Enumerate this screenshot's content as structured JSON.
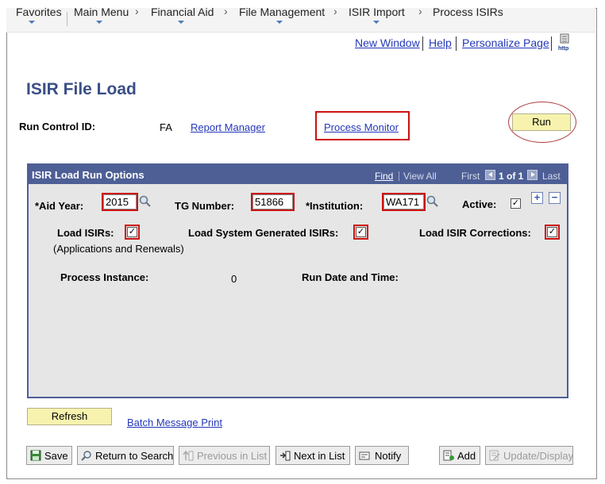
{
  "nav": {
    "items": [
      "Favorites",
      "Main Menu",
      "Financial Aid",
      "File Management",
      "ISIR Import",
      "Process ISIRs"
    ]
  },
  "toplinks": {
    "new_window": "New Window",
    "help": "Help",
    "personalize": "Personalize Page"
  },
  "icon_http_text": "http",
  "page_title": "ISIR File Load",
  "run_control": {
    "label": "Run Control ID:",
    "value": "FA",
    "report_manager": "Report Manager",
    "process_monitor": "Process Monitor",
    "run_button": "Run"
  },
  "panel": {
    "title": "ISIR Load Run Options",
    "find": "Find",
    "view_all": "View All",
    "first": "First",
    "count": "1 of 1",
    "last": "Last",
    "aid_year": {
      "label": "*Aid Year:",
      "value": "2015"
    },
    "tg_number": {
      "label": "TG Number:",
      "value": "51866"
    },
    "institution": {
      "label": "*Institution:",
      "value": "WA171"
    },
    "active": {
      "label": "Active:",
      "checked": true
    },
    "add_symbol": "+",
    "remove_symbol": "−",
    "load_isirs": {
      "label": "Load ISIRs:",
      "checked": true,
      "note": "(Applications and Renewals)"
    },
    "load_system": {
      "label": "Load System Generated ISIRs:",
      "checked": true
    },
    "load_corrections": {
      "label": "Load ISIR Corrections:",
      "checked": true
    },
    "process_instance": {
      "label": "Process Instance:",
      "value": "0"
    },
    "run_date": {
      "label": "Run Date and Time:"
    }
  },
  "refresh_button": "Refresh",
  "batch_message_print": "Batch Message Print",
  "checkmark": "✓",
  "toolbar": {
    "save": "Save",
    "return_to_search": "Return to Search",
    "previous_in_list": "Previous in List",
    "next_in_list": "Next in List",
    "notify": "Notify",
    "add": "Add",
    "update_display": "Update/Display"
  },
  "colors": {
    "title": "#3a4f86",
    "panel_header": "#4e5f96",
    "button_yellow": "#f7f3ae",
    "highlight_red": "#cc1111",
    "link": "#2437b8"
  }
}
